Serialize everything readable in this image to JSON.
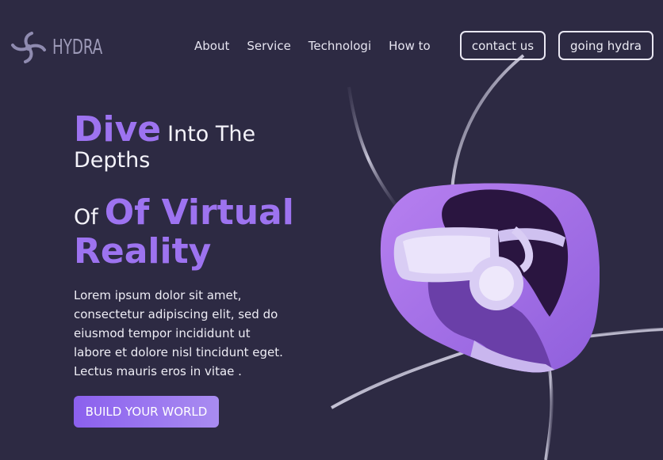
{
  "brand": {
    "name": "HYDRA",
    "logo_icon": "swirl-logo-icon"
  },
  "nav": {
    "items": [
      {
        "label": "About"
      },
      {
        "label": "Service"
      },
      {
        "label": "Technologi"
      },
      {
        "label": "How to"
      }
    ],
    "contact_label": "contact us",
    "going_label": "going hydra"
  },
  "hero": {
    "dive": "Dive",
    "into_the": "Into The",
    "depths": "Depths",
    "of_small": "Of",
    "of_virtual": "Of Virtual",
    "reality": "Reality",
    "description": "Lorem ipsum dolor sit amet, consectetur adipiscing elit, sed do eiusmod tempor incididunt ut labore et dolore nisl tincidunt eget. Lectus mauris eros in vitae .",
    "cta_label": "BUILD YOUR WORLD",
    "image_icon": "vr-headset-person-illustration"
  },
  "colors": {
    "background": "#2d2a43",
    "accent": "#9d73f0",
    "text": "#f4f3fa",
    "blob": "#a574e8"
  }
}
